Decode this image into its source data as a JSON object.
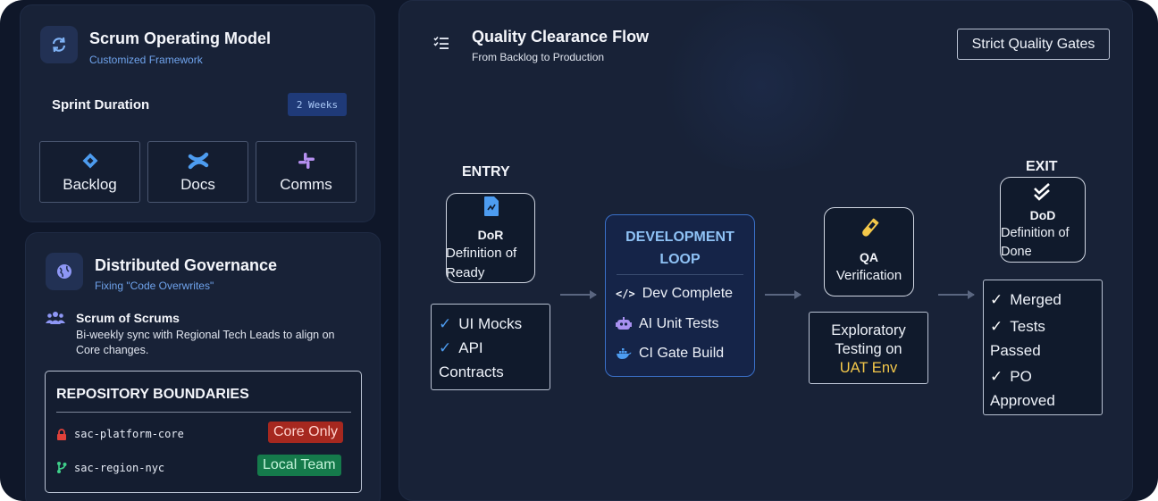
{
  "scrum_card": {
    "title": "Scrum Operating Model",
    "subtitle": "Customized Framework",
    "sprint_label": "Sprint Duration",
    "sprint_value": "2 Weeks",
    "tools": [
      {
        "label": "Backlog",
        "icon": "jira-diamond-icon"
      },
      {
        "label": "Docs",
        "icon": "confluence-icon"
      },
      {
        "label": "Comms",
        "icon": "slack-icon"
      }
    ]
  },
  "governance_card": {
    "title": "Distributed Governance",
    "subtitle": "Fixing \"Code Overwrites\"",
    "sos_title": "Scrum of Scrums",
    "sos_desc_line1": "Bi-weekly sync with Regional Tech Leads to align on",
    "sos_desc_line2": "Core changes.",
    "repo_header": "REPOSITORY BOUNDARIES",
    "repos": [
      {
        "name": "sac-platform-core",
        "badge": "Core Only",
        "icon": "lock-icon",
        "color": "#e0413a"
      },
      {
        "name": "sac-region-nyc",
        "badge": "Local Team",
        "icon": "branch-icon",
        "color": "#3fd08a"
      }
    ]
  },
  "flow": {
    "title": "Quality Clearance Flow",
    "subtitle": "From Backlog to Production",
    "badge": "Strict Quality Gates",
    "entry_label": "ENTRY",
    "exit_label": "EXIT",
    "dor": {
      "abbr": "DoR",
      "line1": "Definition of",
      "line2": "Ready"
    },
    "entry_checks": [
      "UI Mocks",
      "API",
      "Contracts"
    ],
    "dev_loop": {
      "title_line1": "DEVELOPMENT",
      "title_line2": "LOOP",
      "items": [
        "Dev Complete",
        "AI Unit Tests",
        "CI Gate Build"
      ]
    },
    "qa": {
      "abbr": "QA",
      "label": "Verification"
    },
    "exploratory": {
      "line1": "Exploratory",
      "line2": "Testing on",
      "line3": "UAT Env"
    },
    "dod": {
      "abbr": "DoD",
      "line1": "Definition of",
      "line2": "Done"
    },
    "exit_checks": [
      "Merged",
      "Tests",
      "Passed",
      "PO",
      "Approved"
    ]
  },
  "colors": {
    "background": "#0f1729",
    "card": "#182237",
    "accent_blue": "#6fa3ec",
    "dev_title": "#8fc2f5",
    "uat_yellow": "#f4c84a",
    "badge_red": "#a6281f",
    "badge_green": "#157a4b"
  }
}
